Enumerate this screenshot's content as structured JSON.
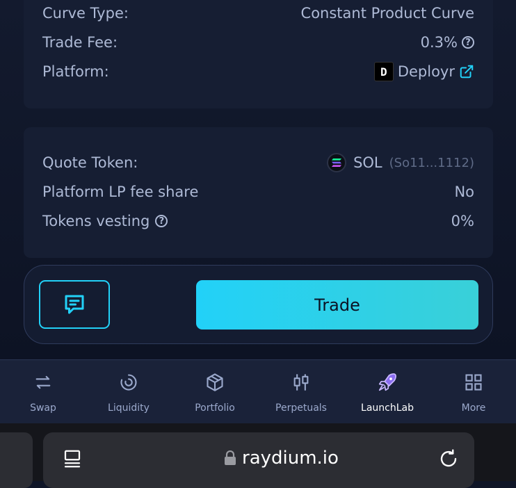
{
  "card_pool": {
    "rows": [
      {
        "label": "Curve Type:",
        "value": "Constant Product Curve"
      },
      {
        "label": "Trade Fee:",
        "value": "0.3%"
      },
      {
        "label": "Platform:",
        "value": "Deployr"
      }
    ]
  },
  "card_token": {
    "quote_label": "Quote Token:",
    "quote_symbol": "SOL",
    "quote_address": "(So11...1112)",
    "lp_label": "Platform LP fee share",
    "lp_value": "No",
    "vesting_label": "Tokens vesting",
    "vesting_value": "0%"
  },
  "actions": {
    "trade_label": "Trade"
  },
  "nav": {
    "items": [
      {
        "label": "Swap",
        "icon": "swap-icon"
      },
      {
        "label": "Liquidity",
        "icon": "liquidity-icon"
      },
      {
        "label": "Portfolio",
        "icon": "portfolio-icon"
      },
      {
        "label": "Perpetuals",
        "icon": "perpetuals-icon"
      },
      {
        "label": "LaunchLab",
        "icon": "rocket-icon"
      },
      {
        "label": "More",
        "icon": "grid-icon"
      }
    ],
    "active": "LaunchLab"
  },
  "browser": {
    "url": "raydium.io"
  },
  "colors": {
    "accent": "#22d1f8",
    "background": "#131a2e",
    "card": "#161e33",
    "text": "#aebad6"
  }
}
